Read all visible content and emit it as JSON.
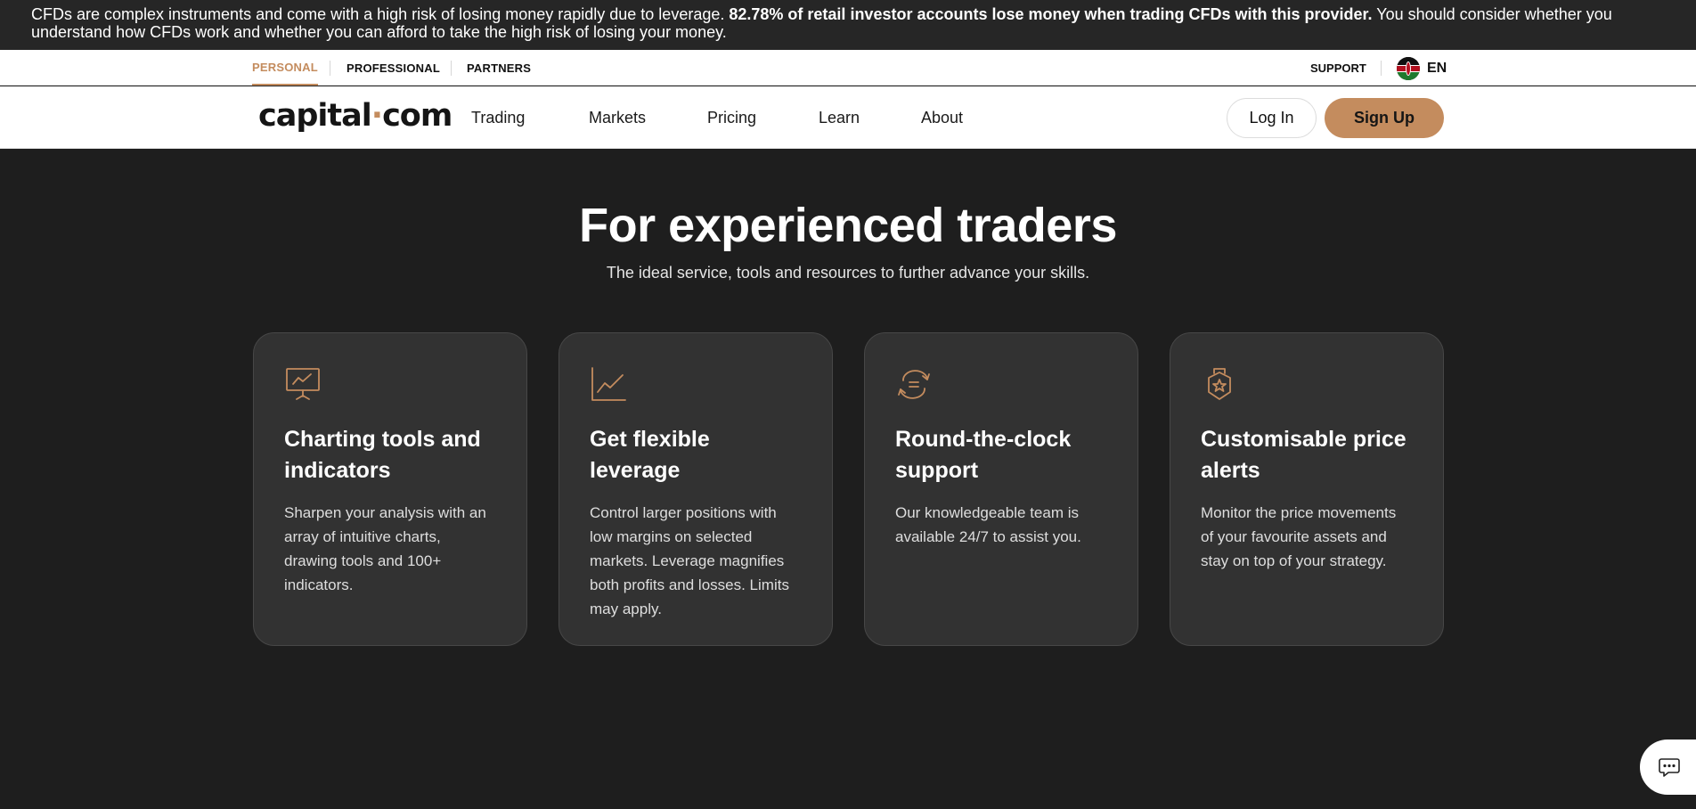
{
  "risk_banner": {
    "text_before": "CFDs are complex instruments and come with a high risk of losing money rapidly due to leverage. ",
    "text_bold": "82.78% of retail investor accounts lose money when trading CFDs with this provider.",
    "text_after": " You should consider whether you understand how CFDs work and whether you can afford to take the high risk of losing your money."
  },
  "topbar": {
    "segments": [
      "PERSONAL",
      "PROFESSIONAL",
      "PARTNERS"
    ],
    "active_segment": "PERSONAL",
    "support_label": "SUPPORT",
    "language": "EN"
  },
  "navbar": {
    "logo_left": "capital",
    "logo_dot": "·",
    "logo_right": "com",
    "links": [
      "Trading",
      "Markets",
      "Pricing",
      "Learn",
      "About"
    ],
    "login_label": "Log In",
    "signup_label": "Sign Up"
  },
  "hero": {
    "title": "For experienced traders",
    "subtitle": "The ideal service, tools and resources to further advance your skills."
  },
  "features": [
    {
      "icon": "presentation-chart-icon",
      "title": "Charting tools and indicators",
      "text": "Sharpen your analysis with an array of intuitive charts, drawing tools and 100+ indicators."
    },
    {
      "icon": "line-chart-icon",
      "title": "Get flexible leverage",
      "text": "Control larger positions with low margins on selected markets. Leverage magnifies both profits and losses. Limits may apply."
    },
    {
      "icon": "chat-arrows-icon",
      "title": "Round-the-clock support",
      "text": "Our knowledgeable team is available 24/7 to assist you."
    },
    {
      "icon": "alert-badge-icon",
      "title": "Customisable price alerts",
      "text": "Monitor the price movements of your favourite assets and stay on top of your strategy."
    }
  ],
  "colors": {
    "accent": "#c48c5e",
    "background": "#1e1e1e",
    "card": "#323232",
    "banner": "#262626"
  }
}
